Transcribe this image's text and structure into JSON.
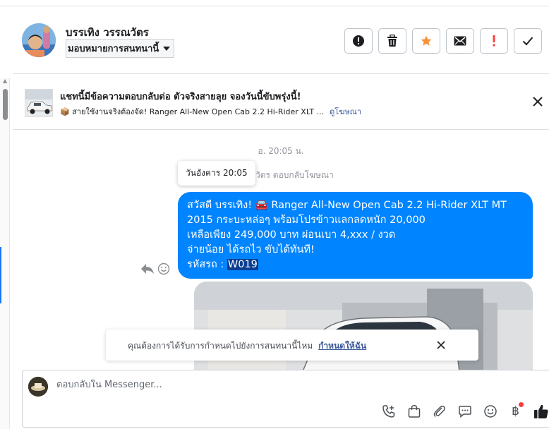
{
  "header": {
    "contact_name": "บรรเทิง วรรณวัตร",
    "assign_label": "มอบหมายการสนทนานี้",
    "actions": [
      {
        "name": "mark-spam-button",
        "icon": "alert-circle-icon"
      },
      {
        "name": "delete-button",
        "icon": "trash-icon"
      },
      {
        "name": "star-button",
        "icon": "star-icon",
        "color": "#f7923b"
      },
      {
        "name": "mark-unread-button",
        "icon": "envelope-icon"
      },
      {
        "name": "follow-up-button",
        "icon": "exclamation-icon",
        "color": "#fa3e3e"
      },
      {
        "name": "mark-done-button",
        "icon": "check-icon"
      }
    ]
  },
  "ad_banner": {
    "title": "แชทนี้มีข้อความตอบกลับต่อ ตัวจริงสายลุย จองวันนี้ขับพรุ่งนี้!",
    "subtitle": "📦 สายใช้งานจริงต้องจัด! Ranger All-New Open Cab 2.2 Hi-Rider XLT ...",
    "link": "ดูโฆษณา"
  },
  "chat": {
    "timestamp": "อ. 20:05 น.",
    "replied_note": "วัตร ตอบกลับโฆษณา",
    "tooltip": "วันอังคาร 20:05",
    "message_lines": [
      "สวัสดี บรรเทิง! 🚘 Ranger All-New Open Cab 2.2 Hi-Rider XLT MT",
      "2015 กระบะหล่อๆ พร้อมโปรข้าวแลกลดหนัก 20,000",
      "เหลือเพียง 249,000 บาท ผ่อนเบา 4,xxx / งวด",
      "จ่ายน้อย ได้รถไว ขับได้ทันที!"
    ],
    "code_label": "รหัสรถ : ",
    "code_value": "W019"
  },
  "notice": {
    "text": "คุณต้องการได้รับการกำหนดไปยังการสนทนานี้ไหม",
    "link": "กำหนดให้ฉัน"
  },
  "composer": {
    "placeholder": "ตอบกลับใน Messenger...",
    "baht_symbol": "฿"
  },
  "colors": {
    "bubble": "#0084ff",
    "link": "#385898",
    "accent": "#1877f2"
  }
}
